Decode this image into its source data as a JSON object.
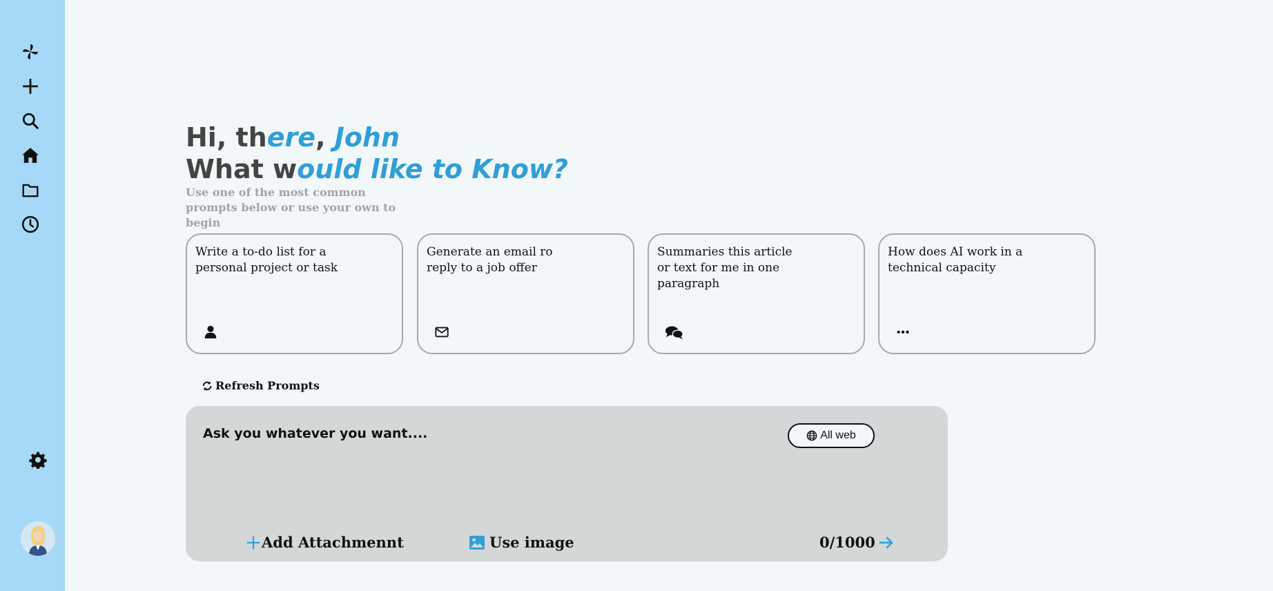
{
  "sidebar": {
    "icons": [
      "pinwheel-logo-icon",
      "plus-icon",
      "search-icon",
      "home-icon",
      "folder-icon",
      "clock-icon",
      "gear-icon"
    ]
  },
  "greeting": {
    "line1_plain": "Hi, th",
    "line1_highlight": "ere",
    "line1_comma": ", ",
    "line1_name": "John",
    "line2_plain": "What w",
    "line2_highlight": "ould like to Know?",
    "subtitle": "Use one of the most common prompts below or use your own to begin"
  },
  "cards": [
    {
      "text": "Write a to-do list for a personal project or task",
      "icon": "user-icon"
    },
    {
      "text": "Generate an email ro reply to a job offer",
      "icon": "envelope-icon"
    },
    {
      "text": "Summaries this article or text for me in one paragraph",
      "icon": "chat-bubbles-icon"
    },
    {
      "text": "How does AI work in a technical capacity",
      "icon": "ellipsis-icon"
    }
  ],
  "refresh_label": "Refresh Prompts",
  "composer": {
    "placeholder": "Ask you whatever you want....",
    "scope_label": "All web",
    "attach_label": "Add Attachmennt",
    "image_label": "Use image",
    "counter": "0/1000"
  },
  "colors": {
    "sidebar_bg": "#a6d9f7",
    "page_bg": "#f2f7fa",
    "accent": "#2f9fd6",
    "composer_bg": "#d4d7d8"
  }
}
